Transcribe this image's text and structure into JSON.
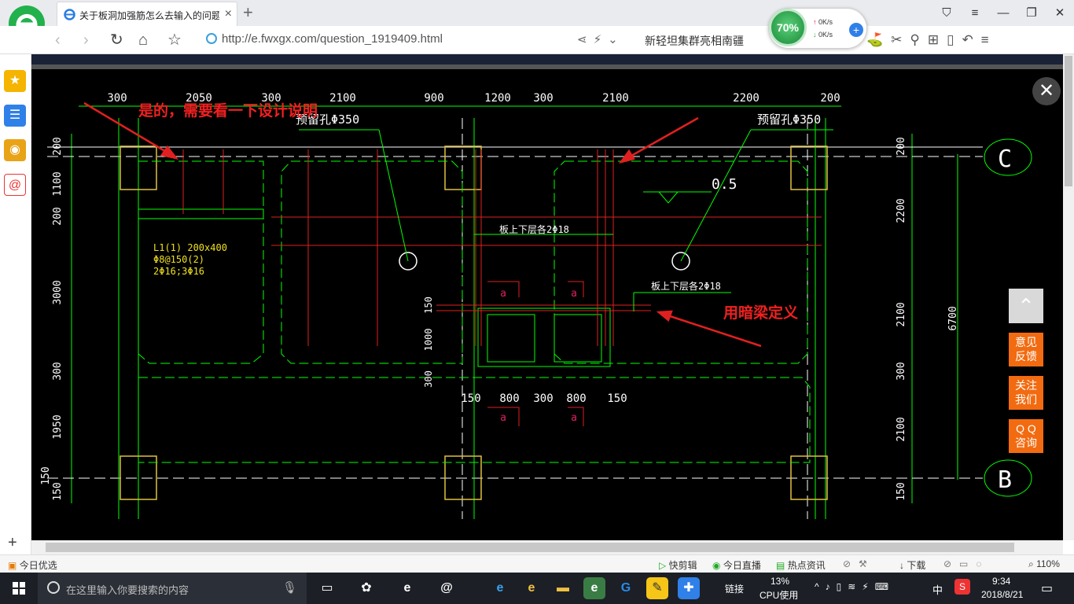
{
  "browser": {
    "tab_title": "关于板洞加强筋怎么去输入的问题",
    "url": "http://e.fwxgx.com/question_1919409.html",
    "hot_search": "新轻坦集群亮相南疆",
    "speed_pct": "70%",
    "up_speed": "0K/s",
    "down_speed": "0K/s"
  },
  "cad": {
    "top_dims": [
      "300",
      "2050",
      "300",
      "2100",
      "900",
      "1200",
      "300",
      "2100",
      "2200",
      "200"
    ],
    "left_dims": [
      "200",
      "1100",
      "200",
      "3000",
      "300",
      "1950",
      "150",
      "150"
    ],
    "right_dims": [
      "200",
      "2200",
      "2100",
      "300",
      "2100",
      "150"
    ],
    "right_total": "6700",
    "bottom_dims": [
      "150",
      "800",
      "300",
      "800",
      "150"
    ],
    "small_dims": [
      "150",
      "1000",
      "300"
    ],
    "hole_label_left": "预留孔Φ350",
    "hole_label_right": "预留孔Φ350",
    "elevation": "0.5",
    "beam_label_1": "板上下层各2Φ18",
    "beam_label_2": "板上下层各2Φ18",
    "beam_spec": [
      "L1(1) 200x400",
      "Φ8@150(2)",
      "2Φ16;3Φ16"
    ],
    "annotation_top": "是的，需要看一下设计说明",
    "annotation_mid": "用暗梁定义",
    "axis_c": "C",
    "axis_b": "B",
    "small_a": [
      "a",
      "a",
      "a",
      "a"
    ]
  },
  "floating": {
    "feedback": [
      "意见",
      "反馈"
    ],
    "follow": [
      "关注",
      "我们"
    ],
    "qq": [
      "Q Q",
      "咨询"
    ]
  },
  "statusbar": {
    "today": "今日优选",
    "kuaijianji": "快剪辑",
    "live": "今日直播",
    "hotnews": "热点资讯",
    "download": "下载",
    "zoom": "110%"
  },
  "taskbar": {
    "search_placeholder": "在这里输入你要搜索的内容",
    "link": "链接",
    "cpu_pct": "13%",
    "cpu_label": "CPU使用",
    "ime": "中",
    "time": "9:34",
    "date": "2018/8/21"
  }
}
